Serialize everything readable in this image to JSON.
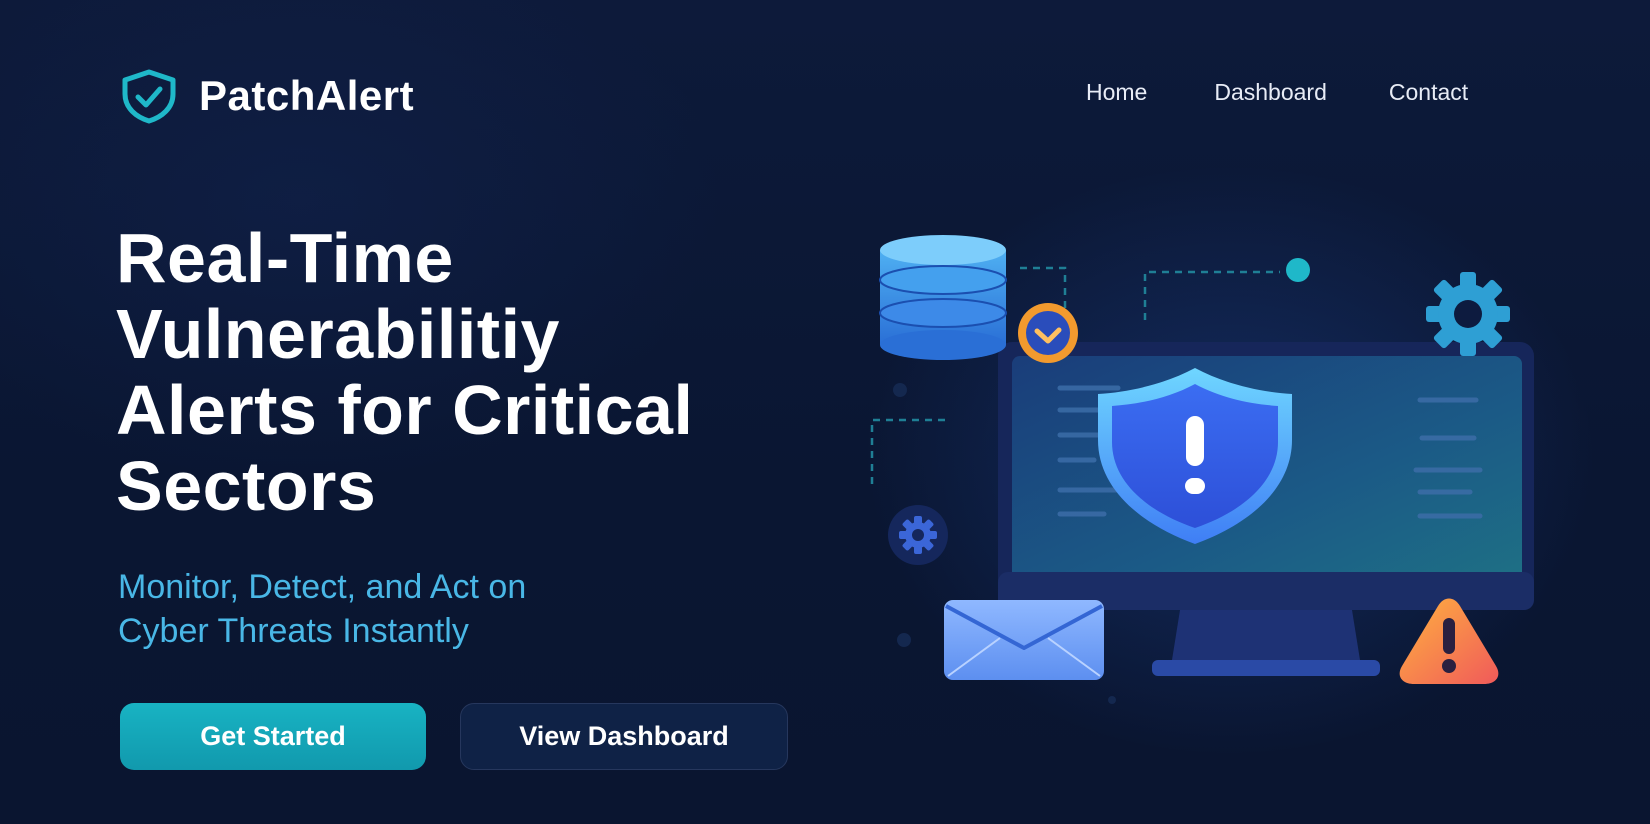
{
  "brand": {
    "name": "PatchAlert",
    "logo_icon": "shield-check-icon",
    "accent": "#1fb8c9"
  },
  "nav": {
    "items": [
      "Home",
      "Dashboard",
      "Contact"
    ]
  },
  "hero": {
    "title_lines": [
      "Real-Time",
      "Vulnerabilitiy",
      "Alerts for Critical",
      "Sectors"
    ],
    "subtitle_lines": [
      "Monitor, Detect, and Act on",
      "Cyber Threats Instantly"
    ],
    "subtitle_color": "#49b7e6"
  },
  "buttons": {
    "primary_label": "Get Started",
    "secondary_label": "View Dashboard",
    "primary_color": "#14a7b9"
  },
  "illustration": {
    "icons": [
      "database-icon",
      "check-badge-icon",
      "monitor-icon",
      "shield-alert-icon",
      "gear-icon",
      "mail-icon",
      "warning-icon"
    ]
  },
  "colors": {
    "background": "#0b1733",
    "text": "#ffffff"
  }
}
